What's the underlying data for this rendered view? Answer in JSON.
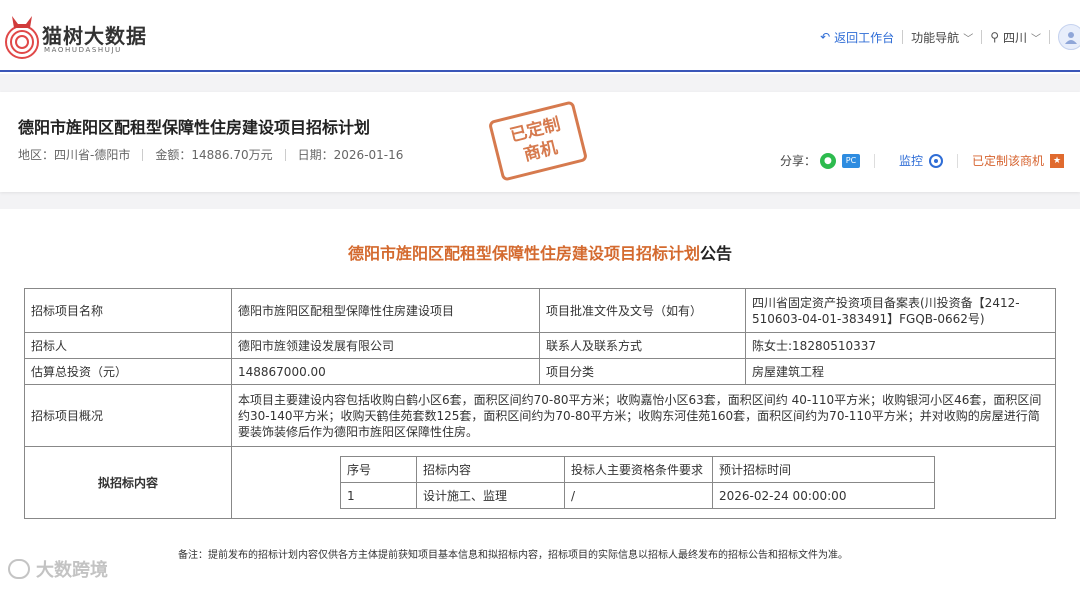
{
  "brand": {
    "name": "猫树大数据",
    "sub": "MAOHUDASHUJU"
  },
  "nav": {
    "back": "返回工作台",
    "func_nav": "功能导航",
    "region": "四川"
  },
  "project": {
    "title": "德阳市旌阳区配租型保障性住房建设项目招标计划",
    "region_label": "地区：",
    "region": "四川省-德阳市",
    "amount_label": "金额：",
    "amount": "14886.70万元",
    "date_label": "日期：",
    "date": "2026-01-16",
    "stamp_line1": "已定制",
    "stamp_line2": "商机",
    "share_label": "分享：",
    "wechat_icon_text": "●",
    "pc_icon_text": "PC",
    "monitor": "监控",
    "customized": "已定制该商机"
  },
  "announcement": {
    "title_main": "德阳市旌阳区配租型保障性住房建设项目招标计划",
    "title_suffix": "公告"
  },
  "table": {
    "r1": {
      "k1": "招标项目名称",
      "v1": "德阳市旌阳区配租型保障性住房建设项目",
      "k2": "项目批准文件及文号（如有）",
      "v2": "四川省固定资产投资项目备案表(川投资备【2412-510603-04-01-383491】FGQB-0662号)"
    },
    "r2": {
      "k1": "招标人",
      "v1": "德阳市旌领建设发展有限公司",
      "k2": "联系人及联系方式",
      "v2": "陈女士:18280510337"
    },
    "r3": {
      "k1": "估算总投资（元）",
      "v1": "148867000.00",
      "k2": "项目分类",
      "v2": "房屋建筑工程"
    },
    "r4": {
      "k1": "招标项目概况",
      "v1": "本项目主要建设内容包括收购白鹤小区6套，面积区间约70-80平方米；收购嘉怡小区63套，面积区间约 40-110平方米；收购银河小区46套，面积区间约30-140平方米；收购天鹤佳苑套数125套，面积区间约为70-80平方米；收购东河佳苑160套，面积区间约为70-110平方米；并对收购的房屋进行简要装饰装修后作为德阳市旌阳区保障性住房。"
    },
    "r5": {
      "k1": "拟招标内容",
      "headers": [
        "序号",
        "招标内容",
        "投标人主要资格条件要求",
        "预计招标时间"
      ],
      "rows": [
        [
          "1",
          "设计施工、监理",
          "/",
          "2026-02-24 00:00:00"
        ]
      ]
    }
  },
  "footnote": "备注：提前发布的招标计划内容仅供各方主体提前获知项目基本信息和拟招标内容，招标项目的实际信息以招标人最终发布的招标公告和招标文件为准。",
  "watermark": "大数跨境"
}
